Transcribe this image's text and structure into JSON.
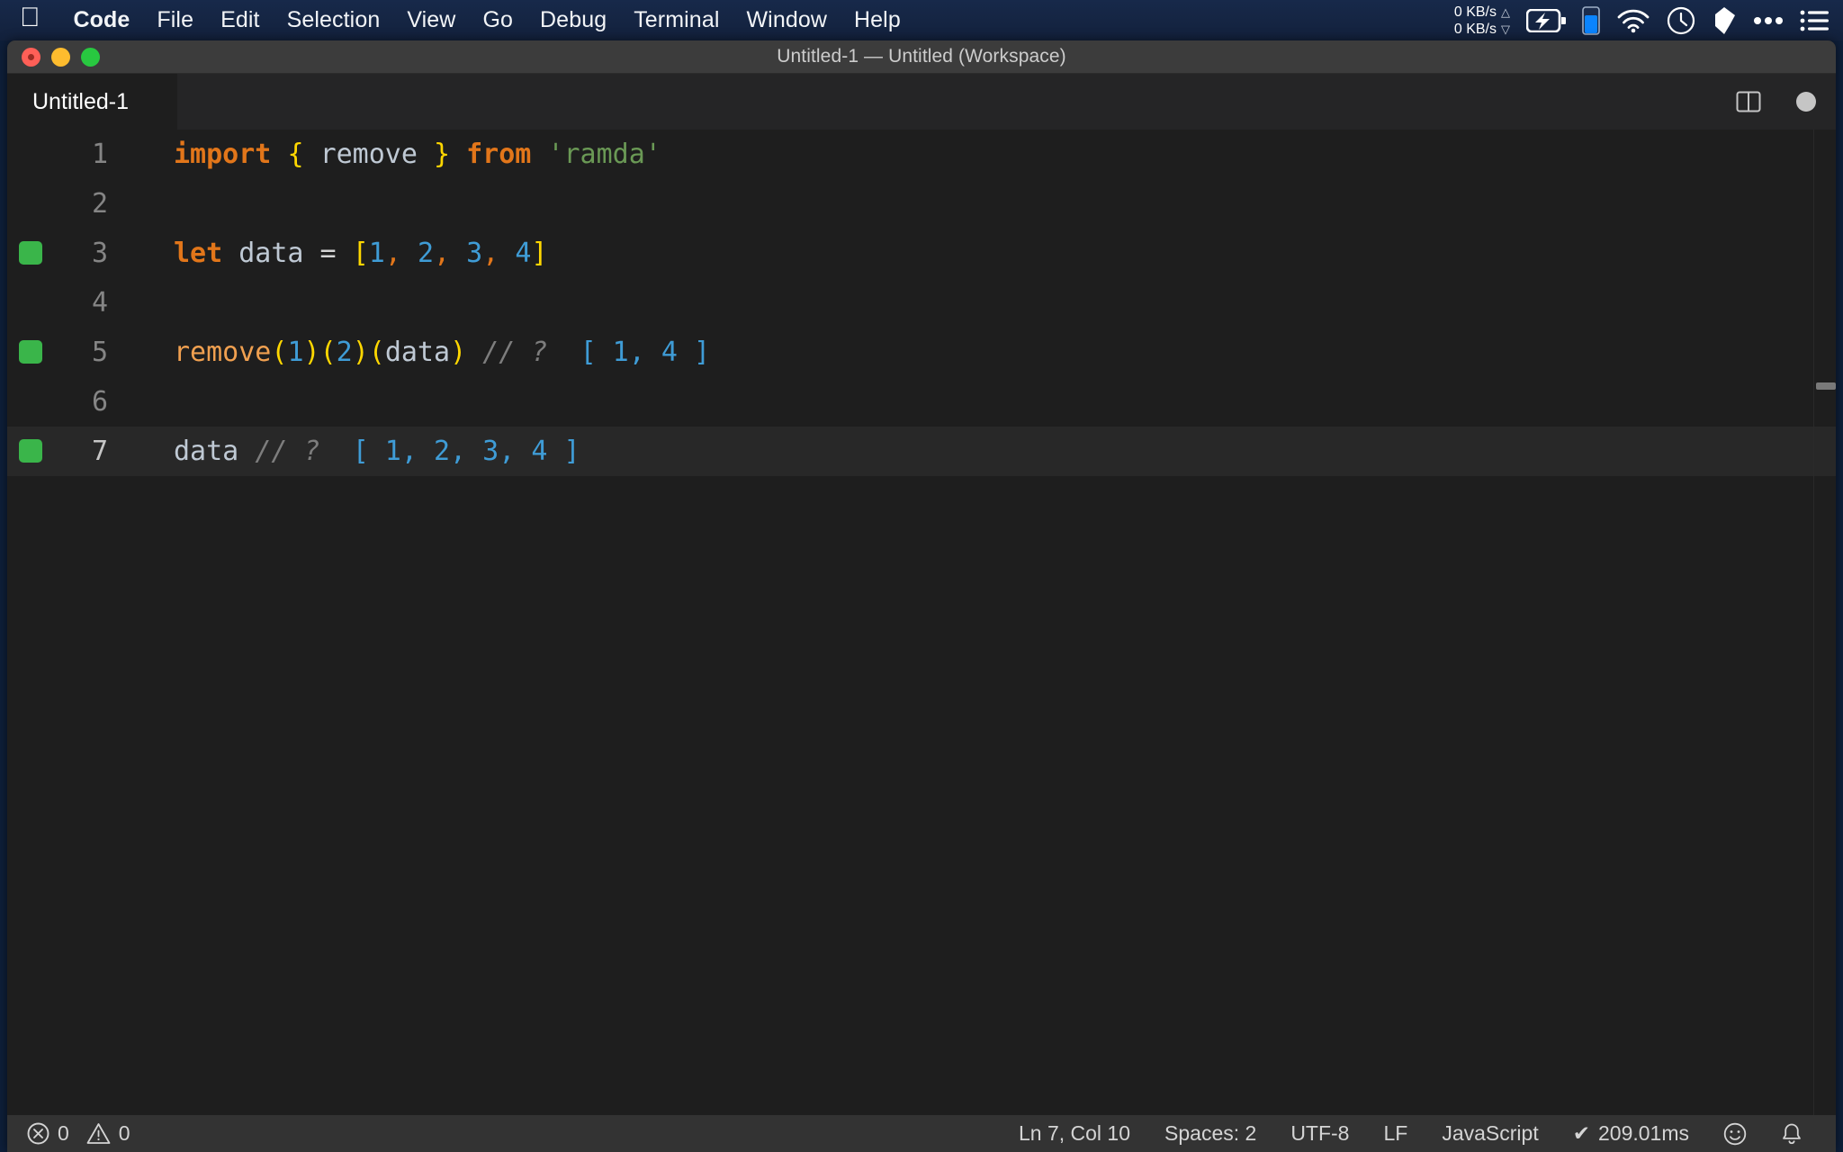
{
  "menubar": {
    "apple_icon": "apple-logo-icon",
    "items": [
      {
        "label": "Code",
        "bold": true
      },
      {
        "label": "File",
        "bold": false
      },
      {
        "label": "Edit",
        "bold": false
      },
      {
        "label": "Selection",
        "bold": false
      },
      {
        "label": "View",
        "bold": false
      },
      {
        "label": "Go",
        "bold": false
      },
      {
        "label": "Debug",
        "bold": false
      },
      {
        "label": "Terminal",
        "bold": false
      },
      {
        "label": "Window",
        "bold": false
      },
      {
        "label": "Help",
        "bold": false
      }
    ],
    "status": {
      "net_up": "0 KB/s",
      "net_down": "0 KB/s",
      "up_arrow": "△",
      "down_arrow": "▽",
      "icons": [
        "battery-charging-icon",
        "vertical-battery-icon",
        "wifi-icon",
        "clock-icon",
        "dropbox-icon",
        "ellipsis-icon",
        "list-menu-icon"
      ]
    }
  },
  "window": {
    "title": "Untitled-1 — Untitled (Workspace)",
    "traffic_lights": [
      "close-button",
      "minimize-button",
      "maximize-button"
    ]
  },
  "tabs": {
    "active": "Untitled-1",
    "split_icon": "split-editor-icon",
    "dirty_indicator": "unsaved-changes-dot"
  },
  "editor": {
    "language": "JavaScript",
    "lines": [
      {
        "number": "1",
        "marker": false,
        "current": false,
        "tokens": [
          {
            "text": "import",
            "cls": "t-kw"
          },
          {
            "text": " ",
            "cls": "t-op"
          },
          {
            "text": "{",
            "cls": "t-brace"
          },
          {
            "text": " ",
            "cls": "t-op"
          },
          {
            "text": "remove",
            "cls": "t-var"
          },
          {
            "text": " ",
            "cls": "t-op"
          },
          {
            "text": "}",
            "cls": "t-brace"
          },
          {
            "text": " ",
            "cls": "t-op"
          },
          {
            "text": "from",
            "cls": "t-kw"
          },
          {
            "text": " ",
            "cls": "t-op"
          },
          {
            "text": "'ramda'",
            "cls": "t-str"
          }
        ]
      },
      {
        "number": "2",
        "marker": false,
        "current": false,
        "tokens": []
      },
      {
        "number": "3",
        "marker": true,
        "current": false,
        "tokens": [
          {
            "text": "let",
            "cls": "t-kw"
          },
          {
            "text": " ",
            "cls": "t-op"
          },
          {
            "text": "data",
            "cls": "t-var"
          },
          {
            "text": " = ",
            "cls": "t-op"
          },
          {
            "text": "[",
            "cls": "t-bracket"
          },
          {
            "text": "1",
            "cls": "t-num"
          },
          {
            "text": ",",
            "cls": "t-comma"
          },
          {
            "text": " ",
            "cls": "t-op"
          },
          {
            "text": "2",
            "cls": "t-num"
          },
          {
            "text": ",",
            "cls": "t-comma"
          },
          {
            "text": " ",
            "cls": "t-op"
          },
          {
            "text": "3",
            "cls": "t-num"
          },
          {
            "text": ",",
            "cls": "t-comma"
          },
          {
            "text": " ",
            "cls": "t-op"
          },
          {
            "text": "4",
            "cls": "t-num"
          },
          {
            "text": "]",
            "cls": "t-bracket"
          }
        ]
      },
      {
        "number": "4",
        "marker": false,
        "current": false,
        "tokens": []
      },
      {
        "number": "5",
        "marker": true,
        "current": false,
        "tokens": [
          {
            "text": "remove",
            "cls": "t-fn"
          },
          {
            "text": "(",
            "cls": "t-bracket"
          },
          {
            "text": "1",
            "cls": "t-num"
          },
          {
            "text": ")",
            "cls": "t-bracket"
          },
          {
            "text": "(",
            "cls": "t-bracket"
          },
          {
            "text": "2",
            "cls": "t-num"
          },
          {
            "text": ")",
            "cls": "t-bracket"
          },
          {
            "text": "(",
            "cls": "t-bracket"
          },
          {
            "text": "data",
            "cls": "t-var"
          },
          {
            "text": ")",
            "cls": "t-bracket"
          },
          {
            "text": " ",
            "cls": "t-op"
          },
          {
            "text": "// ?",
            "cls": "t-comment"
          },
          {
            "text": "  ",
            "cls": "t-op"
          },
          {
            "text": "[ 1, 4 ]",
            "cls": "t-result"
          }
        ]
      },
      {
        "number": "6",
        "marker": false,
        "current": false,
        "tokens": []
      },
      {
        "number": "7",
        "marker": true,
        "current": true,
        "tokens": [
          {
            "text": "data",
            "cls": "t-var"
          },
          {
            "text": " ",
            "cls": "t-op"
          },
          {
            "text": "// ?",
            "cls": "t-comment"
          },
          {
            "text": "  ",
            "cls": "t-op"
          },
          {
            "text": "[ 1, 2, 3, 4 ]",
            "cls": "t-result"
          }
        ]
      }
    ]
  },
  "statusbar": {
    "errors_icon": "error-circle-icon",
    "errors": "0",
    "warnings_icon": "warning-triangle-icon",
    "warnings": "0",
    "cursor": "Ln 7, Col 10",
    "indent": "Spaces: 2",
    "encoding": "UTF-8",
    "eol": "LF",
    "language": "JavaScript",
    "quokka_check": "✔",
    "quokka_time": "209.01ms",
    "feedback_icon": "smiley-icon",
    "notifications_icon": "bell-icon"
  },
  "colors": {
    "menubar_bg": "#17294a",
    "titlebar_bg": "#3c3c3c",
    "tabbar_bg": "#252526",
    "editor_bg": "#1e1e1e",
    "statusbar_bg": "#333333",
    "coverage_green": "#3ab54a",
    "keyword_orange": "#e2761a",
    "brace_yellow": "#ffd700",
    "number_blue": "#3f9cd6",
    "string_green": "#6a9955"
  }
}
